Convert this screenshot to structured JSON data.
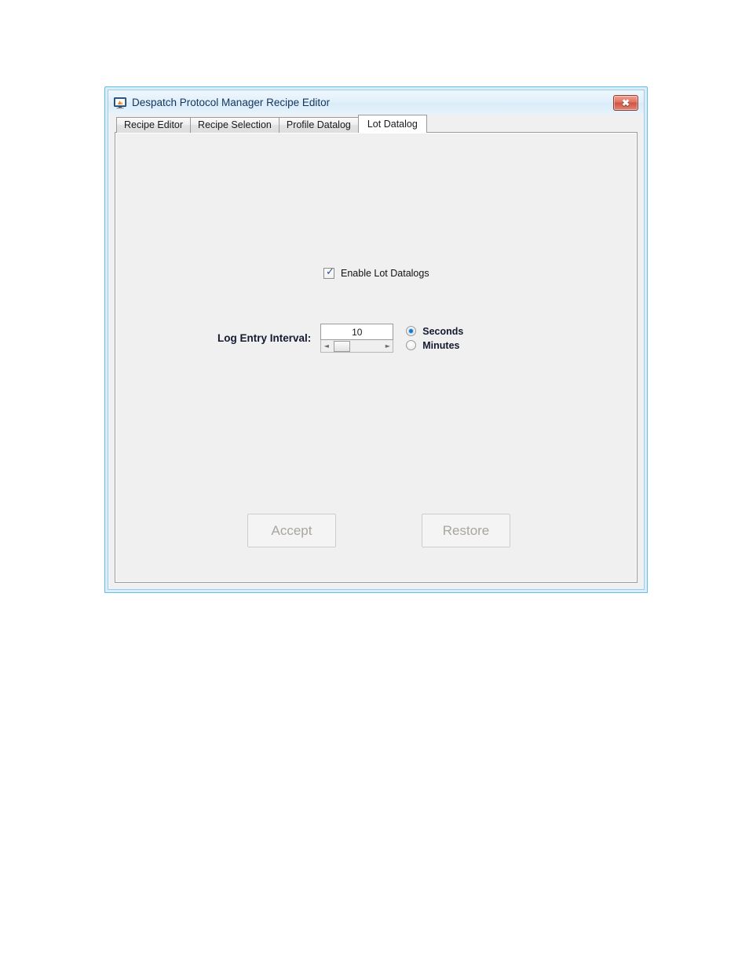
{
  "window": {
    "title": "Despatch Protocol Manager Recipe Editor",
    "icon": "application-monitor-icon",
    "close_label": "✖",
    "close_icon": "close-icon"
  },
  "tabs": [
    {
      "label": "Recipe Editor",
      "active": false
    },
    {
      "label": "Recipe Selection",
      "active": false
    },
    {
      "label": "Profile Datalog",
      "active": false
    },
    {
      "label": "Lot Datalog",
      "active": true
    }
  ],
  "form": {
    "enable_lot_datalogs": {
      "label": "Enable Lot Datalogs",
      "checked": true,
      "check_glyph": "✓"
    },
    "log_entry_interval": {
      "label": "Log Entry Interval:",
      "value": "10",
      "scroll_left_glyph": "◄",
      "scroll_right_glyph": "►"
    },
    "units": [
      {
        "label": "Seconds",
        "selected": true
      },
      {
        "label": "Minutes",
        "selected": false
      }
    ]
  },
  "buttons": [
    {
      "label": "Accept",
      "enabled": false
    },
    {
      "label": "Restore",
      "enabled": false
    }
  ],
  "colors": {
    "window_frame": "#65c0e8",
    "title_text": "#14355c",
    "close_button": "#cf5241",
    "panel_background": "#f0f0f0",
    "radio_accent": "#1579c8",
    "check_accent": "#2b4f9e",
    "disabled_text": "#a9a5a0"
  }
}
